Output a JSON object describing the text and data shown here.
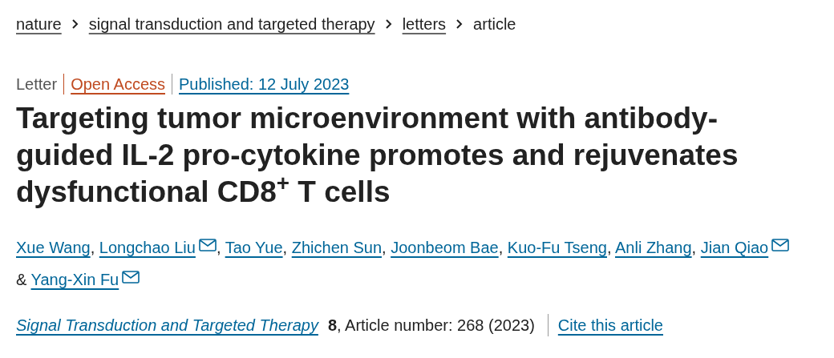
{
  "breadcrumbs": [
    {
      "label": "nature",
      "link": true
    },
    {
      "label": "signal transduction and targeted therapy",
      "link": true
    },
    {
      "label": "letters",
      "link": true
    },
    {
      "label": "article",
      "link": false
    }
  ],
  "article_meta": {
    "type": "Letter",
    "access": "Open Access",
    "published": "Published: 12 July 2023"
  },
  "title": "Targeting tumor microenvironment with antibody-guided IL-2 pro-cytokine promotes and rejuvenates dysfunctional CD8$^{+}$ T cells",
  "authors": [
    {
      "name": "Xue Wang",
      "email": false,
      "suffix": ","
    },
    {
      "name": "Longchao Liu",
      "email": true,
      "suffix": ","
    },
    {
      "name": "Tao Yue",
      "email": false,
      "suffix": ","
    },
    {
      "name": "Zhichen Sun",
      "email": false,
      "suffix": ","
    },
    {
      "name": "Joonbeom Bae",
      "email": false,
      "suffix": ","
    },
    {
      "name": "Kuo-Fu Tseng",
      "email": false,
      "suffix": ","
    },
    {
      "name": "Anli Zhang",
      "email": false,
      "suffix": ","
    },
    {
      "name": "Jian Qiao",
      "email": true
    },
    {
      "name": "Yang-Xin Fu",
      "email": true,
      "conjunction": "&"
    }
  ],
  "citation": {
    "journal": "Signal Transduction and Targeted Therapy",
    "volume": "8",
    "details": ", Article number: 268 (2023)",
    "cite_link": "Cite this article"
  }
}
